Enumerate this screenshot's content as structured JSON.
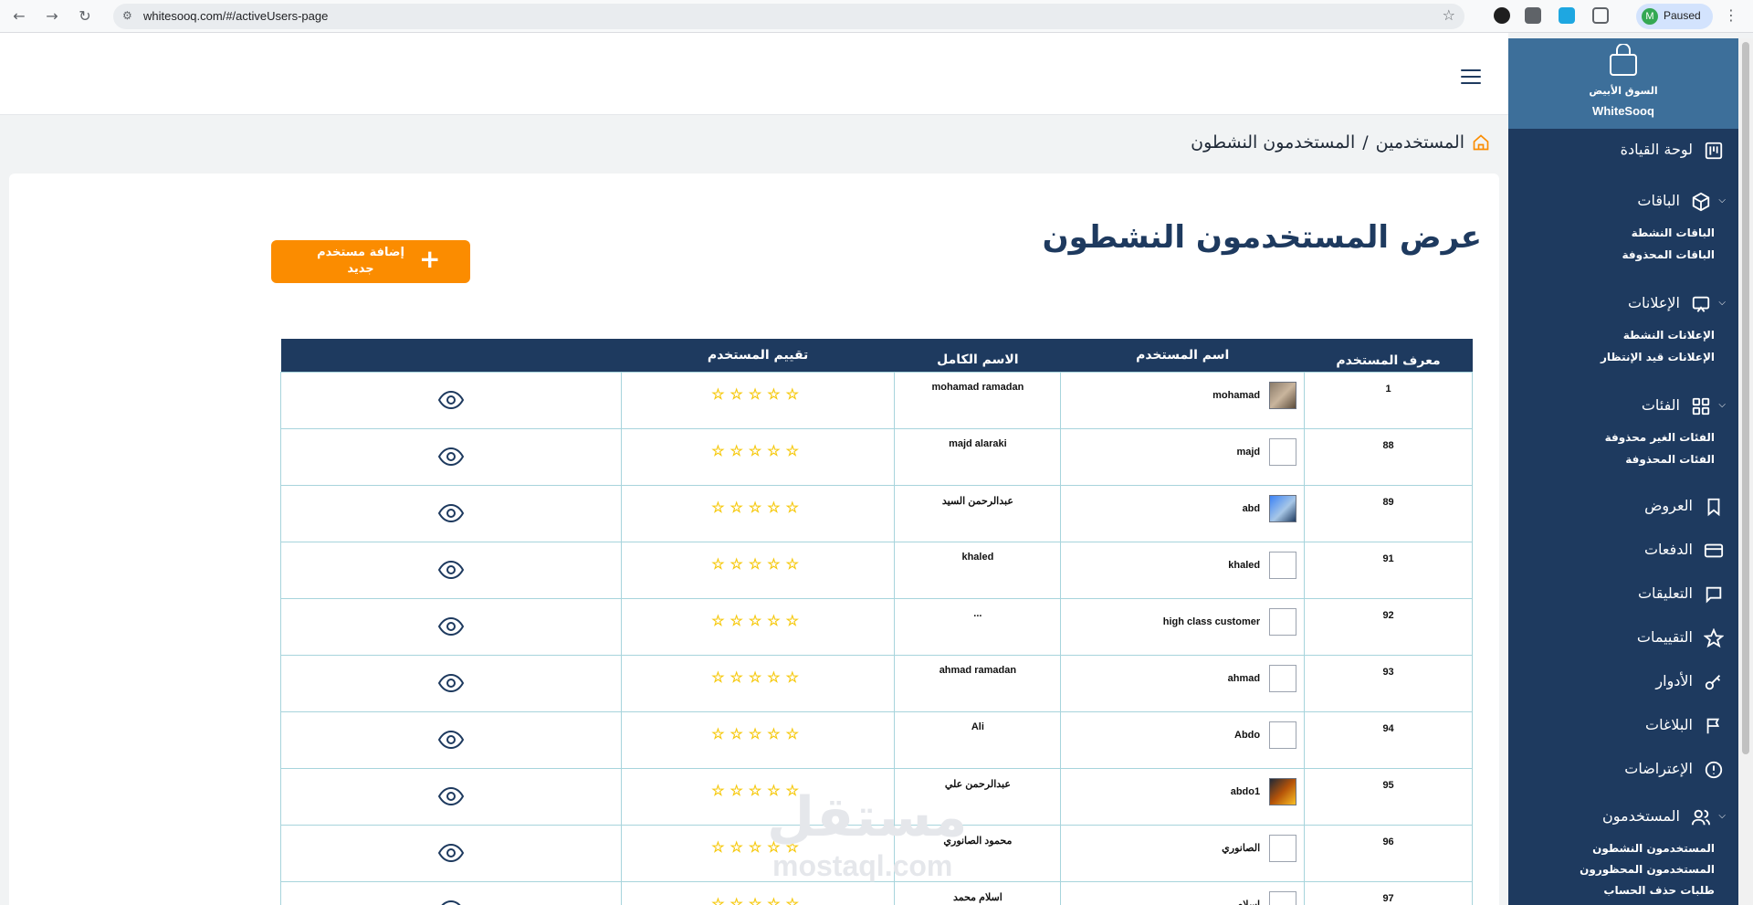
{
  "browser": {
    "url": "whitesooq.com/#/activeUsers-page",
    "profile_initial": "M",
    "profile_status": "Paused"
  },
  "breadcrumb": {
    "parent": "المستخدمين",
    "separator": "/",
    "current": "المستخدمون النشطون"
  },
  "page": {
    "title": "عرض المستخدمون النشطون",
    "add_button_label": "إضافة مستخدم جديد"
  },
  "table": {
    "headers": [
      "معرف المستخدم",
      "اسم المستخدم",
      "الاسم الكامل",
      "تقييم المستخدم",
      ""
    ],
    "rows": [
      {
        "id": "1",
        "username": "mohamad",
        "fullname": "mohamad ramadan",
        "avatar": "photo"
      },
      {
        "id": "88",
        "username": "majd",
        "fullname": "majd alaraki",
        "avatar": "blank"
      },
      {
        "id": "89",
        "username": "abd",
        "fullname": "عبدالرحمن السيد",
        "avatar": "photo2"
      },
      {
        "id": "91",
        "username": "khaled",
        "fullname": "khaled",
        "avatar": "blank"
      },
      {
        "id": "92",
        "username": "high class customer",
        "fullname": "...",
        "avatar": "blank"
      },
      {
        "id": "93",
        "username": "ahmad",
        "fullname": "ahmad ramadan",
        "avatar": "blank"
      },
      {
        "id": "94",
        "username": "Abdo",
        "fullname": "Ali",
        "avatar": "blank"
      },
      {
        "id": "95",
        "username": "abdo1",
        "fullname": "عبدالرحمن علي",
        "avatar": "photo3"
      },
      {
        "id": "96",
        "username": "الصانوري",
        "fullname": "محمود الصانوري",
        "avatar": "blank"
      },
      {
        "id": "97",
        "username": "اسلام",
        "fullname": "اسلام محمد",
        "avatar": "blank"
      }
    ],
    "rating_stars": "☆☆☆☆☆"
  },
  "sidebar": {
    "logo_ar": "السوق الأبيض",
    "logo_en": "WhiteSooq",
    "items": {
      "dashboard": "لوحة القيادة",
      "packages": "الباقات",
      "packages_active": "الباقات النشطة",
      "packages_deleted": "الباقات المحذوفة",
      "ads": "الإعلانات",
      "ads_active": "الإعلانات النشطة",
      "ads_pending": "الإعلانات قيد الإنتظار",
      "categories": "الفئات",
      "categories_not_deleted": "الفئات الغير محذوفة",
      "categories_deleted": "الفئات المحذوفة",
      "offers": "العروض",
      "payments": "الدفعات",
      "comments": "التعليقات",
      "ratings": "التقييمات",
      "roles": "الأدوار",
      "reports": "البلاغات",
      "objections": "الإعتراضات",
      "users": "المستخدمون",
      "users_active": "المستخدمون النشطون",
      "users_banned": "المستخدمون المحظورون",
      "users_delete_requests": "طلبات حذف الحساب"
    }
  },
  "watermark": {
    "ar": "مستقل",
    "en": "mostaql.com"
  },
  "colors": {
    "sidebar": "#1e3a5f",
    "logo_bg": "#3d6f9a",
    "accent": "#fb8c00",
    "star": "#f6c90e",
    "table_header": "#1e3a5f"
  }
}
